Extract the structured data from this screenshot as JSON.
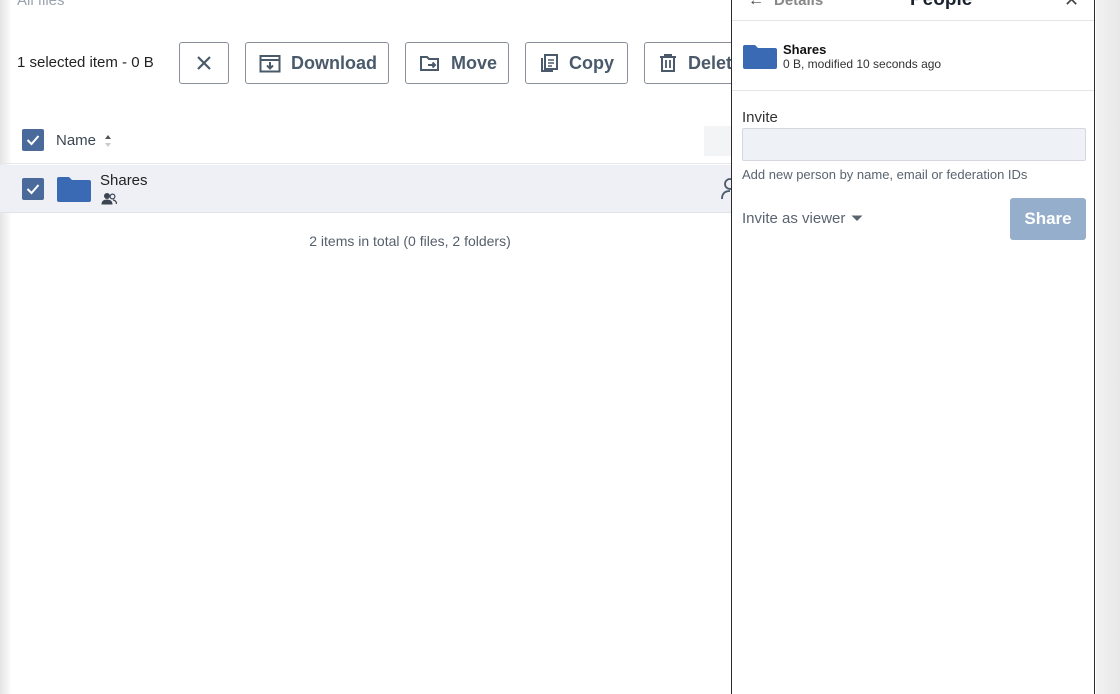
{
  "breadcrumb": {
    "label": "All files"
  },
  "toolbar": {
    "selection_info": "1 selected item - 0 B",
    "download_label": "Download",
    "move_label": "Move",
    "copy_label": "Copy",
    "delete_label": "Delete"
  },
  "table": {
    "name_header": "Name",
    "rows": [
      {
        "name": "Shares"
      }
    ],
    "total": "2 items in total (0 files, 2 folders)"
  },
  "panel": {
    "details_label": "Details",
    "title": "People",
    "item": {
      "name": "Shares",
      "meta": "0 B, modified 10 seconds ago"
    },
    "invite_label": "Invite",
    "invite_value": "",
    "invite_hint": "Add new person by name, email or federation IDs",
    "role_label": "Invite as viewer",
    "share_label": "Share"
  },
  "colors": {
    "accent": "#4a6a9c",
    "folder": "#3a6ab4",
    "share_button": "#94aecb"
  },
  "icons": [
    "close-icon",
    "download-icon",
    "move-icon",
    "copy-icon",
    "trash-icon",
    "checkmark-icon",
    "sort-icon",
    "folder-icon",
    "shared-people-icon",
    "user-icon",
    "back-arrow-icon",
    "chevron-down-icon"
  ]
}
